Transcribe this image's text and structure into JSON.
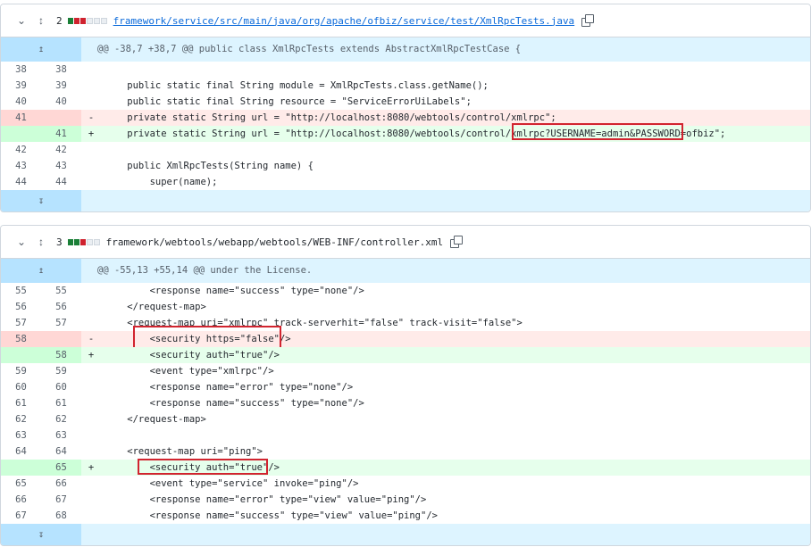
{
  "files": [
    {
      "count": "2",
      "filename": "framework/service/src/main/java/org/apache/ofbiz/service/test/XmlRpcTests.java",
      "hunk_header": "@@ -38,7 +38,7 @@ public class XmlRpcTests extends AbstractXmlRpcTestCase {",
      "lines": [
        {
          "old": "38",
          "new": "38",
          "sign": "",
          "type": "ctx",
          "text": ""
        },
        {
          "old": "39",
          "new": "39",
          "sign": "",
          "type": "ctx",
          "text": "    public static final String module = XmlRpcTests.class.getName();"
        },
        {
          "old": "40",
          "new": "40",
          "sign": "",
          "type": "ctx",
          "text": "    public static final String resource = \"ServiceErrorUiLabels\";"
        },
        {
          "old": "41",
          "new": "",
          "sign": "-",
          "type": "del",
          "text": "    private static String url = \"http://localhost:8080/webtools/control/xmlrpc\";"
        },
        {
          "old": "",
          "new": "41",
          "sign": "+",
          "type": "add",
          "text": "    private static String url = \"http://localhost:8080/webtools/control/xmlrpc?USERNAME=admin&PASSWORD=ofbiz\";"
        },
        {
          "old": "42",
          "new": "42",
          "sign": "",
          "type": "ctx",
          "text": ""
        },
        {
          "old": "43",
          "new": "43",
          "sign": "",
          "type": "ctx",
          "text": "    public XmlRpcTests(String name) {"
        },
        {
          "old": "44",
          "new": "44",
          "sign": "",
          "type": "ctx",
          "text": "        super(name);"
        }
      ]
    },
    {
      "count": "3",
      "filename": "framework/webtools/webapp/webtools/WEB-INF/controller.xml",
      "hunk_header": "@@ -55,13 +55,14 @@ under the License.",
      "lines": [
        {
          "old": "55",
          "new": "55",
          "sign": "",
          "type": "ctx",
          "text": "        <response name=\"success\" type=\"none\"/>"
        },
        {
          "old": "56",
          "new": "56",
          "sign": "",
          "type": "ctx",
          "text": "    </request-map>"
        },
        {
          "old": "57",
          "new": "57",
          "sign": "",
          "type": "ctx",
          "text": "    <request-map uri=\"xmlrpc\" track-serverhit=\"false\" track-visit=\"false\">"
        },
        {
          "old": "58",
          "new": "",
          "sign": "-",
          "type": "del",
          "text": "        <security https=\"false\"/>"
        },
        {
          "old": "",
          "new": "58",
          "sign": "+",
          "type": "add",
          "text": "        <security auth=\"true\"/>"
        },
        {
          "old": "59",
          "new": "59",
          "sign": "",
          "type": "ctx",
          "text": "        <event type=\"xmlrpc\"/>"
        },
        {
          "old": "60",
          "new": "60",
          "sign": "",
          "type": "ctx",
          "text": "        <response name=\"error\" type=\"none\"/>"
        },
        {
          "old": "61",
          "new": "61",
          "sign": "",
          "type": "ctx",
          "text": "        <response name=\"success\" type=\"none\"/>"
        },
        {
          "old": "62",
          "new": "62",
          "sign": "",
          "type": "ctx",
          "text": "    </request-map>"
        },
        {
          "old": "63",
          "new": "63",
          "sign": "",
          "type": "ctx",
          "text": ""
        },
        {
          "old": "64",
          "new": "64",
          "sign": "",
          "type": "ctx",
          "text": "    <request-map uri=\"ping\">"
        },
        {
          "old": "",
          "new": "65",
          "sign": "+",
          "type": "add",
          "text": "        <security auth=\"true\"/>"
        },
        {
          "old": "65",
          "new": "66",
          "sign": "",
          "type": "ctx",
          "text": "        <event type=\"service\" invoke=\"ping\"/>"
        },
        {
          "old": "66",
          "new": "67",
          "sign": "",
          "type": "ctx",
          "text": "        <response name=\"error\" type=\"view\" value=\"ping\"/>"
        },
        {
          "old": "67",
          "new": "68",
          "sign": "",
          "type": "ctx",
          "text": "        <response name=\"success\" type=\"view\" value=\"ping\"/>"
        }
      ]
    }
  ],
  "icons": {
    "collapse": "chevron-down-icon",
    "expand_file": "unfold-icon",
    "copy": "copy-icon",
    "expand_up": "expand-up-icon",
    "expand_down": "expand-down-icon"
  },
  "colors": {
    "added_bg": "#e6ffec",
    "deleted_bg": "#ffebe9",
    "hunk_bg": "#ddf4ff",
    "highlight_box": "#d1242f"
  }
}
